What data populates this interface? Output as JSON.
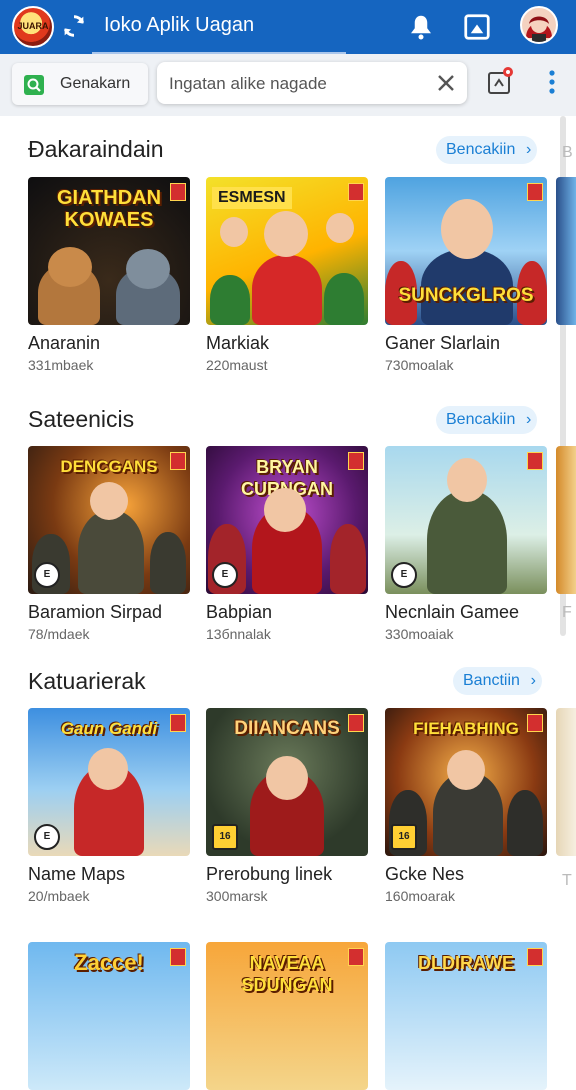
{
  "app": {
    "title": "Ioko Aplik Uagan",
    "logo_text": "JUARA"
  },
  "search": {
    "chip_label": "Genakarn",
    "placeholder": "Ingatan alike nagade"
  },
  "sections": [
    {
      "title": "Đakaraindain",
      "see_all": "Bencakiin",
      "edge_letter": "B",
      "cards": [
        {
          "name": "Anaranin",
          "sub": "331mbaek",
          "banner": "GIATHDAN KOWAES",
          "icon": "bears-game-thumbnail"
        },
        {
          "name": "Markiak",
          "sub": "220maust",
          "banner": "ESMESN",
          "icon": "soccer-team-thumbnail"
        },
        {
          "name": "Ganer Slarlain",
          "sub": "730moalak",
          "banner": "SUNCKGLROS",
          "icon": "hero-boy-thumbnail"
        }
      ]
    },
    {
      "title": "Sateenicis",
      "see_all": "Bencakiin",
      "edge_letter": "F",
      "cards": [
        {
          "name": "Baramion Sirpad",
          "sub": "78/mdaek",
          "banner": "DENCGANS",
          "icon": "soldiers-battle-thumbnail"
        },
        {
          "name": "Babpian",
          "sub": "13бnnalak",
          "banner": "BRYAN CURNGAN",
          "icon": "red-warriors-thumbnail"
        },
        {
          "name": "Necnlain Gamee",
          "sub": "330moaiak",
          "banner": "",
          "icon": "green-soldier-thumbnail"
        }
      ]
    },
    {
      "title": "Katuarierak",
      "see_all": "Banctiin",
      "edge_letter": "T",
      "cards": [
        {
          "name": "Name Maps",
          "sub": "20/mbaek",
          "banner": "Gaun Gandi",
          "icon": "red-hero-thumbnail"
        },
        {
          "name": "Prerobung linek",
          "sub": "300marsk",
          "banner": "DIIANCANS",
          "icon": "red-hat-girl-thumbnail"
        },
        {
          "name": "Gcke Nes",
          "sub": "160moarak",
          "banner": "FIEHABHING",
          "icon": "squad-fight-thumbnail"
        }
      ]
    },
    {
      "title": "",
      "see_all": "",
      "cards": [
        {
          "name": "",
          "sub": "",
          "banner": "Zacce!",
          "icon": "kids-adventure-thumbnail"
        },
        {
          "name": "",
          "sub": "",
          "banner": "NAVEAA SDUNGAN",
          "icon": "gunner-thumbnail"
        },
        {
          "name": "",
          "sub": "",
          "banner": "DLDIRAWE",
          "icon": "cartoon-friends-thumbnail"
        }
      ]
    }
  ],
  "age_labels": {
    "e": "E",
    "t": "16"
  },
  "colors": {
    "appbar": "#1565c0",
    "accent": "#1a7fd4",
    "chip_bg": "#e6f2fc"
  }
}
